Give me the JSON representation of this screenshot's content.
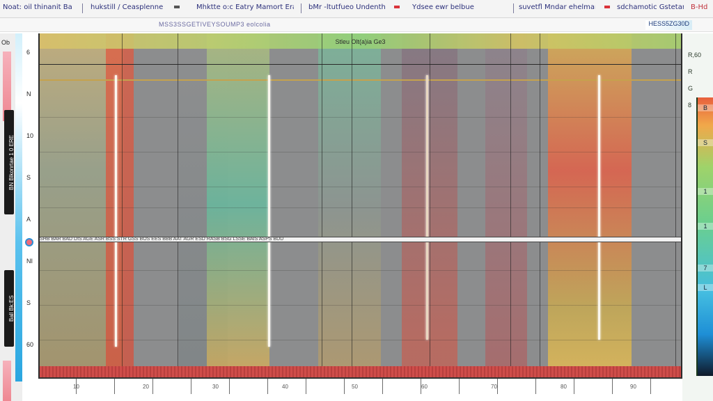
{
  "tabs": [
    {
      "label": "Noat: oil thinanit Bast"
    },
    {
      "label": "hukstill / Ceasplenne"
    },
    {
      "label": "Mhktte o:c Eatry Mamort Eral"
    },
    {
      "label": "bMr -ltutfueo Undenthe"
    },
    {
      "label": "Ydsee ewr belbue"
    },
    {
      "label": "suvetfl Mndar ehelmarts"
    },
    {
      "label": "sdchamotic Gstetanec"
    },
    {
      "label": "B-Hd"
    }
  ],
  "subheader": {
    "title": "MSS3SSGETIVEYSOUMP3 eolcolia",
    "right_label": "HESS5ZG30D"
  },
  "left_rail": {
    "top_label": "Ob",
    "labels": [
      "6",
      "N",
      "10",
      "S",
      "A",
      "NI",
      "S",
      "60"
    ],
    "vertical_texts": [
      "BN Blkonrtae 1 0 ERE",
      "Ball Bk:ES"
    ]
  },
  "plot": {
    "title": "Stleu Olt(a)ia Ge3",
    "center_strip_text": "SHB  BAR  BAD  DIS  AGE  ASR  BSS  STR  GSS  BOS  EES  BBB  AAT  AGR  ESD  RASB  BSG  LSSE  BAIS  ASPS  BDD",
    "columns": [
      {
        "color": "#9fd06f"
      },
      {
        "color": "#c99a8a"
      },
      {
        "color": "#8fa0a0"
      },
      {
        "color": "#d9a050"
      },
      {
        "color": "#7fc8b0"
      },
      {
        "color": "#d6c35a"
      },
      {
        "color": "#8fa0a0"
      },
      {
        "color": "#6fc38f"
      }
    ]
  },
  "xaxis": {
    "labels": [
      "10",
      "20",
      "30",
      "40",
      "50",
      "60",
      "70",
      "80",
      "90"
    ]
  },
  "right_panel": {
    "labels": [
      "R,60",
      "R",
      "G",
      "8"
    ],
    "colorbar_ticks": [
      "B",
      "S",
      "1",
      "1",
      "7",
      "L"
    ]
  }
}
